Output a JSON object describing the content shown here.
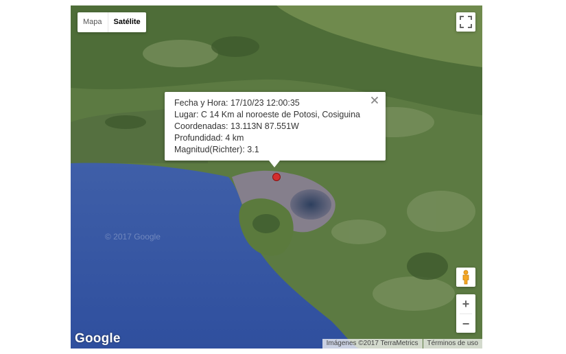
{
  "map_type": {
    "options": [
      "Mapa",
      "Satélite"
    ],
    "selected": "Satélite"
  },
  "info_window": {
    "lines": [
      "Fecha y Hora: 17/10/23 12:00:35",
      "Lugar: C 14 Km al noroeste de Potosi, Cosiguina",
      "Coordenadas: 13.113N 87.551W",
      "Profundidad: 4 km",
      "Magnitud(Richter): 3.1"
    ]
  },
  "watermark": "© 2017 Google",
  "logo": "Google",
  "attribution": {
    "imagery": "Imágenes ©2017 TerraMetrics",
    "terms": "Términos de uso"
  },
  "zoom": {
    "in_label": "+",
    "out_label": "−"
  },
  "icons": [
    "fullscreen-icon",
    "close-icon",
    "pegman-icon",
    "marker-icon"
  ]
}
